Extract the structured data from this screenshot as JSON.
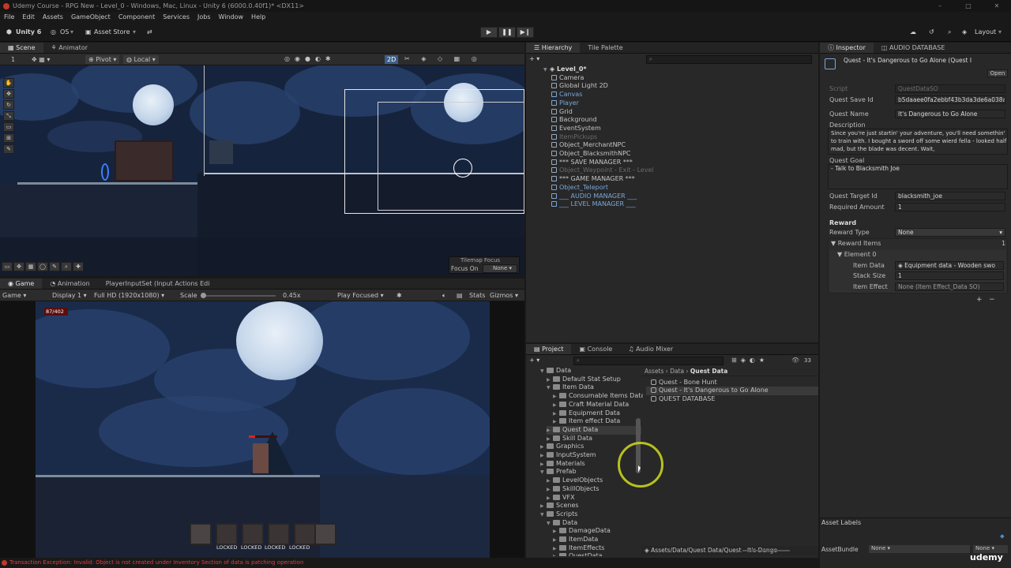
{
  "window": {
    "title": "Udemy Course - RPG New - Level_0 - Windows, Mac, Linux - Unity 6 (6000.0.40f1)* <DX11>",
    "controls": [
      "–",
      "□",
      "✕"
    ]
  },
  "menu": [
    "File",
    "Edit",
    "Assets",
    "GameObject",
    "Component",
    "Services",
    "Jobs",
    "Window",
    "Help"
  ],
  "toolbar": {
    "account": "Unity 6",
    "os": "OS",
    "asset_store": "Asset Store",
    "layout": "Layout"
  },
  "scene": {
    "tabs": [
      "Scene",
      "Animator"
    ],
    "layer_index": "1",
    "pivot": "Pivot",
    "local": "Local",
    "mode_2d": "2D",
    "tilemap_focus_label": "Tilemap Focus",
    "focus_on_label": "Focus On",
    "focus_value": "None"
  },
  "game": {
    "tabs": [
      "Game",
      "Animation",
      "PlayerInputSet (Input Actions Edi"
    ],
    "display_mode": "Game",
    "display": "Display 1",
    "resolution": "Full HD (1920x1080)",
    "scale_label": "Scale",
    "scale_value": "0.45x",
    "play_focused": "Play Focused",
    "stats": "Stats",
    "gizmos": "Gizmos",
    "health_text": "87/402",
    "health_fraction": 0.216,
    "locked_labels": [
      "LOCKED",
      "LOCKED",
      "LOCKED",
      "LOCKED"
    ]
  },
  "hierarchy": {
    "tabs": [
      "Hierarchy",
      "Tile Palette"
    ],
    "scene_name": "Level_0*",
    "items": [
      {
        "label": "Camera",
        "style": "normal"
      },
      {
        "label": "Global Light 2D",
        "style": "normal"
      },
      {
        "label": "Canvas",
        "style": "blue"
      },
      {
        "label": "Player",
        "style": "blue"
      },
      {
        "label": "Grid",
        "style": "normal"
      },
      {
        "label": "Background",
        "style": "normal"
      },
      {
        "label": "EventSystem",
        "style": "normal"
      },
      {
        "label": "ItemPickups",
        "style": "dim"
      },
      {
        "label": "Object_MerchantNPC",
        "style": "normal"
      },
      {
        "label": "Object_BlacksmithNPC",
        "style": "normal"
      },
      {
        "label": "*** SAVE MANAGER ***",
        "style": "normal"
      },
      {
        "label": "Object_Waypoint - Exit - Level",
        "style": "dim"
      },
      {
        "label": "*** GAME MANAGER ***",
        "style": "normal"
      },
      {
        "label": "Object_Teleport",
        "style": "blue"
      },
      {
        "label": "___ AUDIO MANAGER ___",
        "style": "blue"
      },
      {
        "label": "___ LEVEL MANAGER ___",
        "style": "blue"
      }
    ]
  },
  "inspector": {
    "tabs": [
      "Inspector",
      "AUDIO DATABASE"
    ],
    "header_title": "Quest - It's Dangerous to Go Alone (Quest I",
    "open_button": "Open",
    "fields": {
      "script_label": "Script",
      "script_value": "QuestDataSO",
      "save_id_label": "Quest Save Id",
      "save_id_value": "b5daaee0fa2ebbf43b3da3de6a038a",
      "name_label": "Quest Name",
      "name_value": "It's Dangerous to Go Alone",
      "description_label": "Description",
      "description_value": "Since you're just startin' your adventure, you'll need somethin' to train with. I bought a sword off some wierd fella - looked half mad, but the blade was decent. Wait,",
      "goal_label": "Quest Goal",
      "goal_value": "- Talk to Blacksmith Joe",
      "target_label": "Quest Target Id",
      "target_value": "blacksmith_joe",
      "amount_label": "Required Amount",
      "amount_value": "1"
    },
    "reward": {
      "section": "Reward",
      "type_label": "Reward Type",
      "type_value": "None",
      "items_label": "Reward Items",
      "items_count": "1",
      "element_label": "Element 0",
      "item_data_label": "Item Data",
      "item_data_value": "Equipment data - Wooden swo",
      "stack_label": "Stack Size",
      "stack_value": "1",
      "effect_label": "Item Effect",
      "effect_value": "None (Item Effect_Data SO)"
    },
    "asset_labels": "Asset Labels",
    "asset_bundle_label": "AssetBundle",
    "asset_bundle_value": "None",
    "asset_bundle_variant": "None"
  },
  "project": {
    "tabs": [
      "Project",
      "Console",
      "Audio Mixer"
    ],
    "hidden_count": "33",
    "tree": [
      {
        "label": "Data",
        "indent": 1,
        "open": true
      },
      {
        "label": "Default Stat Setup",
        "indent": 2,
        "open": false
      },
      {
        "label": "Item Data",
        "indent": 2,
        "open": true
      },
      {
        "label": "Consumable Items Data",
        "indent": 3,
        "open": false
      },
      {
        "label": "Craft Material Data",
        "indent": 3,
        "open": false
      },
      {
        "label": "Equipment Data",
        "indent": 3,
        "open": false
      },
      {
        "label": "Item effect Data",
        "indent": 3,
        "open": false
      },
      {
        "label": "Quest Data",
        "indent": 2,
        "open": false,
        "selected": true
      },
      {
        "label": "Skill Data",
        "indent": 2,
        "open": false
      },
      {
        "label": "Graphics",
        "indent": 1,
        "open": false
      },
      {
        "label": "InputSystem",
        "indent": 1,
        "open": false
      },
      {
        "label": "Materials",
        "indent": 1,
        "open": false
      },
      {
        "label": "Prefab",
        "indent": 1,
        "open": true
      },
      {
        "label": "LevelObjects",
        "indent": 2,
        "open": false
      },
      {
        "label": "SkillObjects",
        "indent": 2,
        "open": false
      },
      {
        "label": "VFX",
        "indent": 2,
        "open": false
      },
      {
        "label": "Scenes",
        "indent": 1,
        "open": false
      },
      {
        "label": "Scripts",
        "indent": 1,
        "open": true
      },
      {
        "label": "Data",
        "indent": 2,
        "open": true
      },
      {
        "label": "DamageData",
        "indent": 3,
        "open": false
      },
      {
        "label": "ItemData",
        "indent": 3,
        "open": false
      },
      {
        "label": "ItemEffects",
        "indent": 3,
        "open": false
      },
      {
        "label": "QuestData",
        "indent": 3,
        "open": false
      }
    ],
    "breadcrumb": [
      "Assets",
      "Data",
      "Quest Data"
    ],
    "files": [
      "Quest - Bone Hunt",
      "Quest - It's Dangerous to Go Alone",
      "QUEST DATABASE"
    ],
    "path_bar": "Assets/Data/Quest Data/Quest - It's Dange"
  },
  "status": {
    "error_text": "Transaction Exception: Invalid: Object is not created under Inventory Section of data is patching operation"
  },
  "watermark": "udemy"
}
